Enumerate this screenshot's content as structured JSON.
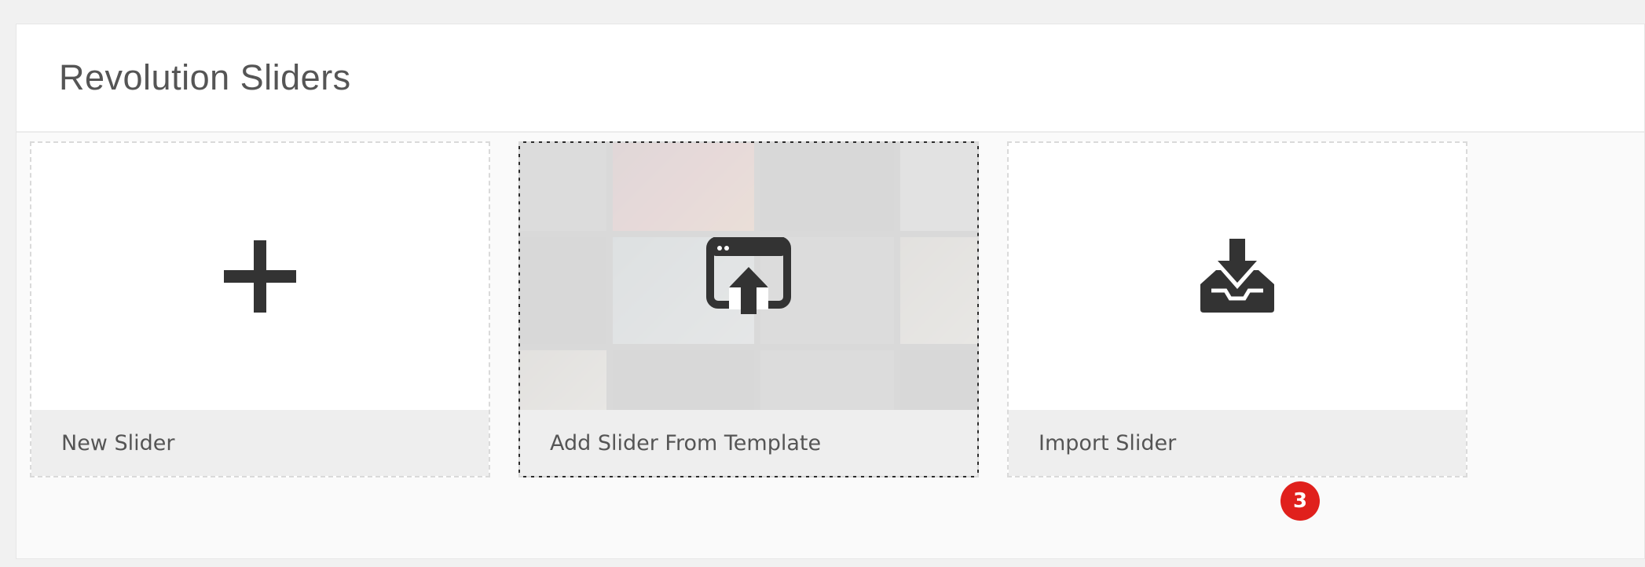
{
  "header": {
    "title": "Revolution Sliders"
  },
  "cards": [
    {
      "label": "New Slider",
      "icon": "plus-icon"
    },
    {
      "label": "Add Slider From Template",
      "icon": "browser-upload-icon"
    },
    {
      "label": "Import Slider",
      "icon": "tray-download-icon"
    }
  ],
  "annotation": {
    "badge": "3"
  },
  "colors": {
    "background": "#f1f1f1",
    "panel": "#fafafa",
    "card_footer": "#eeeeee",
    "icon": "#333333",
    "badge": "#e0201c"
  }
}
